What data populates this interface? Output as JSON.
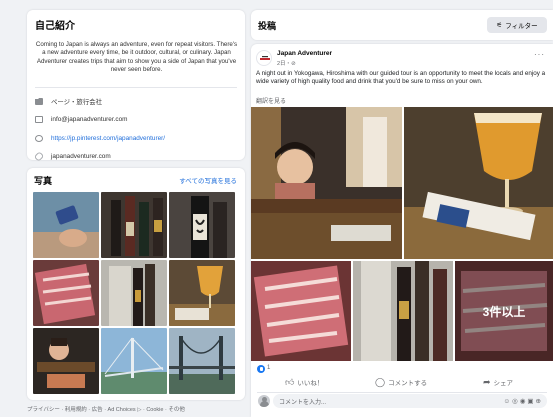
{
  "intro": {
    "title": "自己紹介",
    "bio": "Coming to Japan is always an adventure, even for repeat visitors. There's a new adventure every time, be it outdoor, cultural, or culinary. Japan Adventurer creates trips that aim to show you a side of Japan that you've never seen before.",
    "category": "ページ・旅行会社",
    "email": "info@japanadventurer.com",
    "pinterest": "https://jp.pinterest.com/japanadventurer/",
    "website": "japanadventurer.com"
  },
  "photos": {
    "title": "写真",
    "see_all": "すべての写真を見る"
  },
  "posts": {
    "title": "投稿",
    "filter_label": "フィルター"
  },
  "post": {
    "page_name": "Japan Adventurer",
    "time": "2日・",
    "text": "A night out in Yokogawa, Hiroshima with our guided tour is an opportunity to meet the locals and enjoy a wide variety of high quality food and drink that you'd be sure to miss on your own.",
    "translate": "翻訳を見る",
    "more_photos": "3件以上",
    "reaction_count": "1",
    "like_label": "いいね！",
    "comment_label": "コメントする",
    "share_label": "シェア",
    "comment_placeholder": "コメントを入力..."
  },
  "footer": {
    "links": "プライバシー · 利用規約 · 広告 · Ad Choices ▷ · Cookie · その他"
  },
  "colors": {
    "link": "#216fdb",
    "accent": "#1877f2",
    "background": "#f0f2f5"
  }
}
